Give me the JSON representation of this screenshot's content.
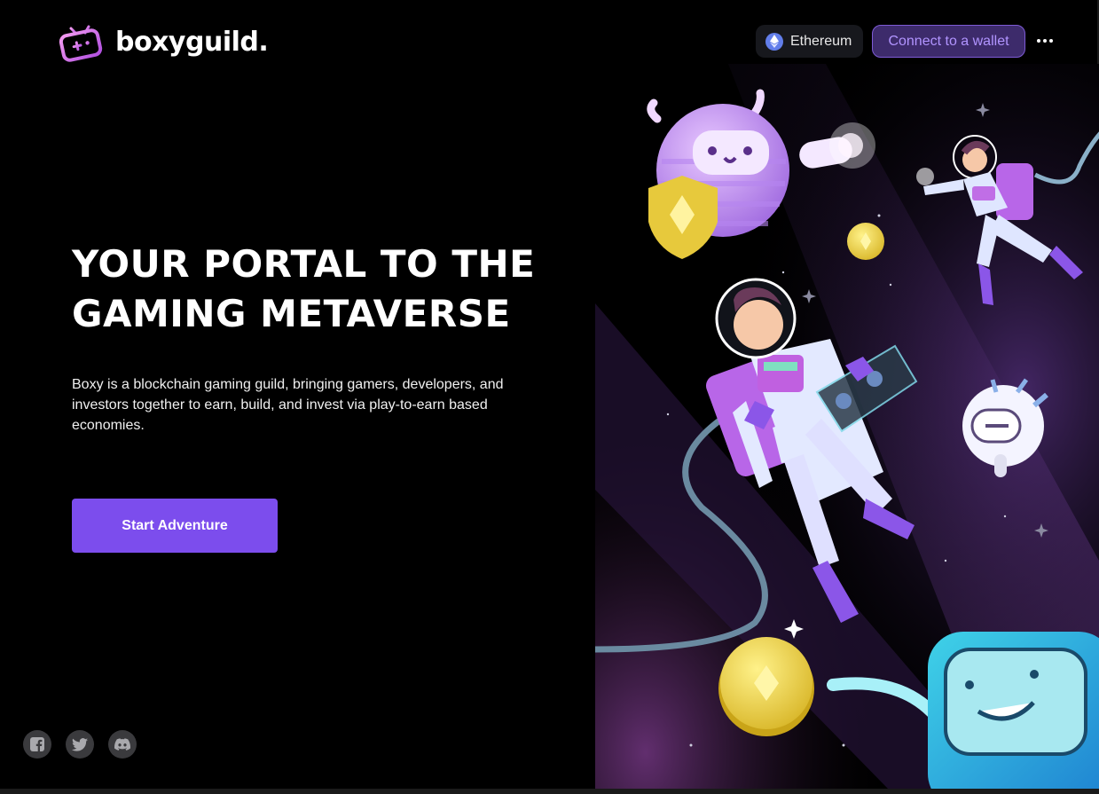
{
  "brand": {
    "name": "boxyguild.",
    "logo_icon": "gamepad-tv-icon"
  },
  "header": {
    "network_label": "Ethereum",
    "network_icon": "ethereum-icon",
    "connect_label": "Connect to a wallet",
    "more_icon": "more-dots-icon"
  },
  "hero": {
    "title": "YOUR PORTAL TO THE GAMING METAVERSE",
    "description": "Boxy is a blockchain gaming guild, bringing gamers, developers, and investors together to earn, build, and invest via play-to-earn based economies.",
    "cta_label": "Start Adventure"
  },
  "socials": [
    {
      "name": "facebook",
      "icon": "facebook-icon"
    },
    {
      "name": "twitter",
      "icon": "twitter-icon"
    },
    {
      "name": "discord",
      "icon": "discord-icon"
    }
  ],
  "colors": {
    "accent": "#7c4ded",
    "wallet_text": "#b194ff",
    "background": "#000000"
  }
}
